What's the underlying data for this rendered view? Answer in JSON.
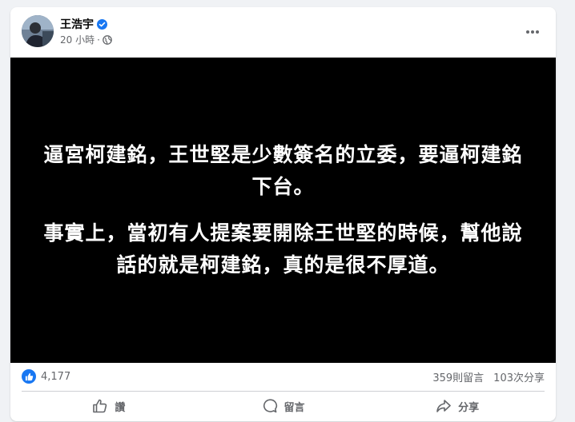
{
  "post": {
    "author": "王浩宇",
    "time": "20 小時",
    "separator": "·",
    "verified_icon": "verified-badge-icon",
    "audience_icon": "globe-icon",
    "more_icon": "more-options-icon"
  },
  "image": {
    "paragraphs": [
      "逼宮柯建銘，王世堅是少數簽名的立委，要逼柯建銘下台。",
      "事實上，當初有人提案要開除王世堅的時候，幫他說話的就是柯建銘，真的是很不厚道。"
    ]
  },
  "stats": {
    "likes": "4,177",
    "comments": "359則留言",
    "shares": "103次分享"
  },
  "actions": {
    "like": "讚",
    "comment": "留言",
    "share": "分享"
  },
  "colors": {
    "accent": "#1877f2",
    "muted_text": "#65676b",
    "image_background": "#000000"
  }
}
